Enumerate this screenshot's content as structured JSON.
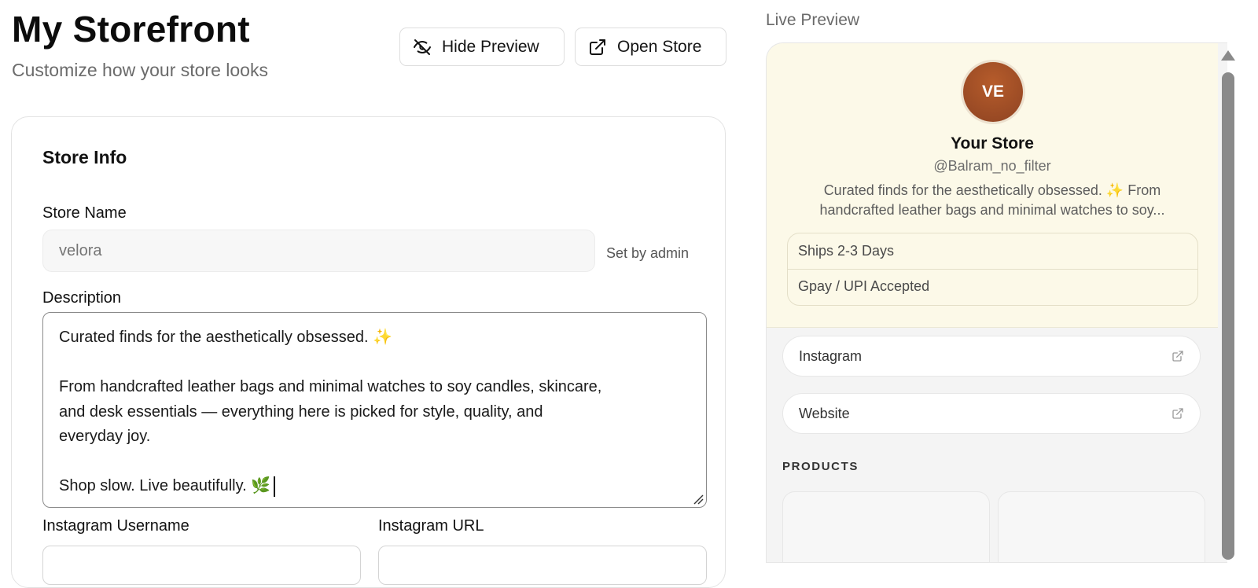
{
  "header": {
    "title": "My Storefront",
    "subtitle": "Customize how your store looks",
    "hide_preview_label": "Hide Preview",
    "open_store_label": "Open Store"
  },
  "store_info": {
    "title": "Store Info",
    "store_name_label": "Store Name",
    "store_name_placeholder": "velora",
    "store_name_note": "Set by admin",
    "description_label": "Description",
    "description_lines": {
      "l1": "Curated finds for the aesthetically obsessed.",
      "l1_emoji": "✨",
      "l3": "From handcrafted leather bags and minimal watches to soy candles, skincare,",
      "l4": "and desk essentials — everything here is picked for style, quality, and",
      "l5": "everyday joy.",
      "l7": "Shop slow. Live beautifully.",
      "l7_emoji": "🌿"
    },
    "instagram_username_label": "Instagram Username",
    "instagram_url_label": "Instagram URL"
  },
  "preview": {
    "label": "Live Preview",
    "avatar_initials": "VE",
    "store_name": "Your Store",
    "handle": "@Balram_no_filter",
    "desc_line1": "Curated finds for the aesthetically obsessed. ✨ From",
    "desc_line2": "handcrafted leather bags and minimal watches to soy...",
    "pills": [
      "Ships 2-3 Days",
      "Gpay / UPI Accepted"
    ],
    "links": [
      "Instagram",
      "Website"
    ],
    "products_label": "PRODUCTS"
  },
  "colors": {
    "preview_header_bg": "#fcf9e8",
    "avatar": "#a24d26"
  }
}
